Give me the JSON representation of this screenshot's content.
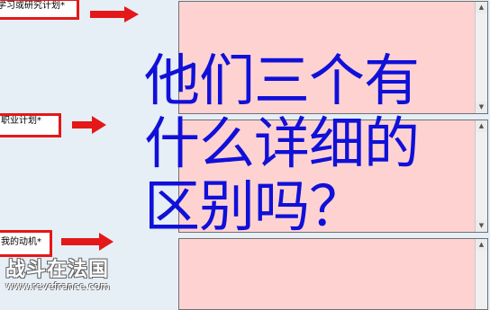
{
  "fields": [
    {
      "label": "学习或研究计划*"
    },
    {
      "label": "职业计划*"
    },
    {
      "label": "我的动机*"
    }
  ],
  "overlay": {
    "line1": "他们三个有",
    "line2": "什么详细的",
    "line3": "区别吗？"
  },
  "watermark": {
    "text": "战斗在法国",
    "url": "www.revefrance.com"
  },
  "scroll_up_icon": "▲",
  "scroll_down_icon": "▼",
  "colors": {
    "label_border": "#e41818",
    "arrow": "#e41818",
    "textarea_bg": "#ffd2d2",
    "overlay_text": "#1010d8"
  }
}
